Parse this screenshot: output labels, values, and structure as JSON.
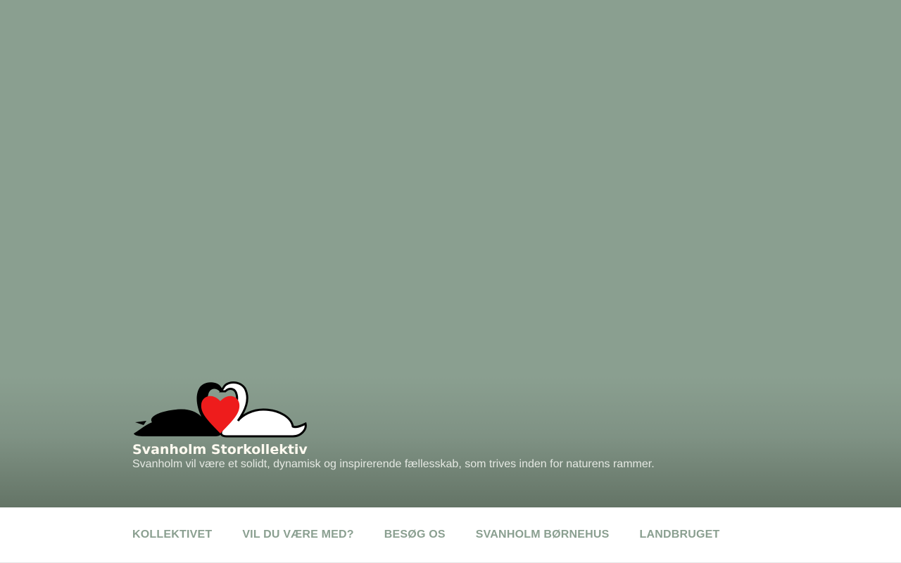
{
  "site": {
    "title": "Svanholm Storkollektiv",
    "tagline": "Svanholm vil være et solidt, dynamisk og inspirerende fællesskab, som trives inden for naturens rammer."
  },
  "logo": {
    "icon": "two-swans-heart-logo"
  },
  "navigation": {
    "items": [
      {
        "label": "KOLLEKTIVET"
      },
      {
        "label": "VIL DU VÆRE MED?"
      },
      {
        "label": "BESØG OS"
      },
      {
        "label": "SVANHOLM BØRNEHUS"
      },
      {
        "label": "LANDBRUGET"
      }
    ]
  },
  "colors": {
    "hero_background": "#8a9f90",
    "nav_text": "#8a9f90",
    "heart": "#ee1c1c"
  }
}
